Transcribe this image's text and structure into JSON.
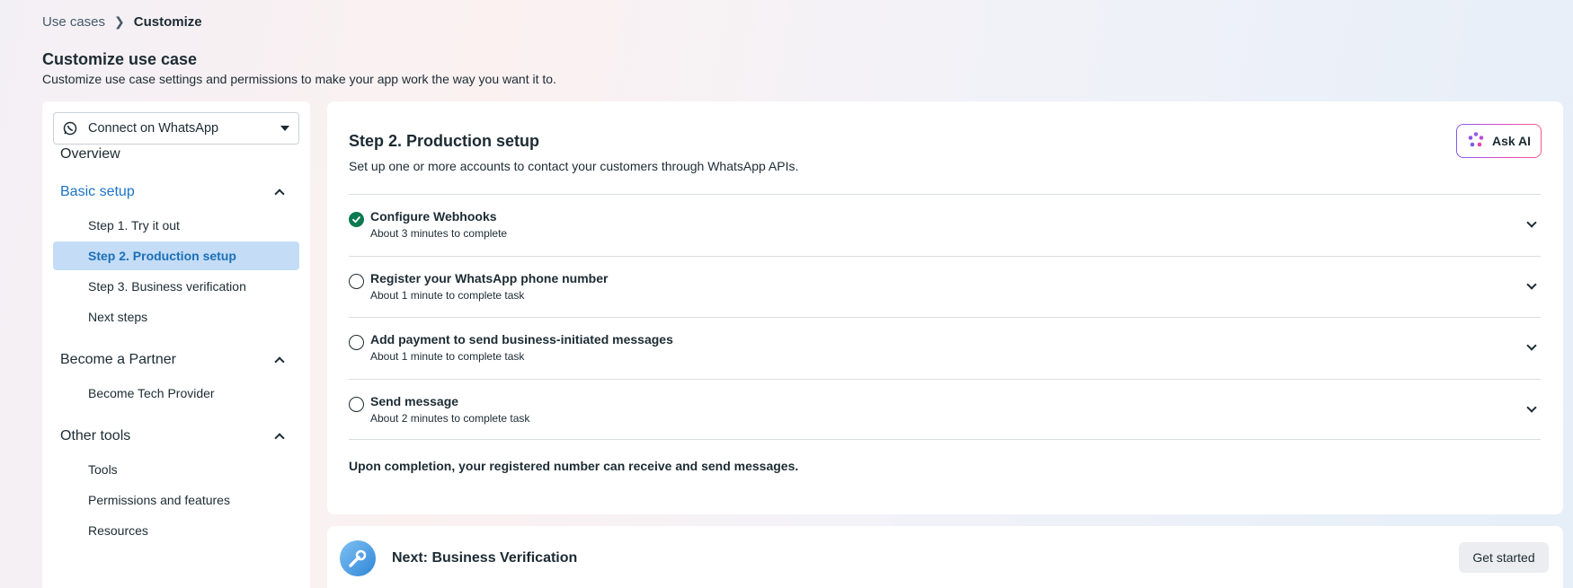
{
  "breadcrumb": {
    "parent": "Use cases",
    "current": "Customize"
  },
  "header": {
    "title": "Customize use case",
    "subtitle": "Customize use case settings and permissions to make your app work the way you want it to."
  },
  "sidebar": {
    "use_case_select": {
      "value": "Connect on WhatsApp",
      "icon": "whatsapp-icon"
    },
    "overview_label": "Overview",
    "sections": [
      {
        "label": "Basic setup",
        "active": true,
        "items": [
          "Step 1. Try it out",
          "Step 2. Production setup",
          "Step 3. Business verification",
          "Next steps"
        ]
      },
      {
        "label": "Become a Partner",
        "items": [
          "Become Tech Provider"
        ]
      },
      {
        "label": "Other tools",
        "items": [
          "Tools",
          "Permissions and features",
          "Resources"
        ]
      }
    ],
    "selected_item": "Step 2. Production setup"
  },
  "main": {
    "title": "Step 2. Production setup",
    "subtitle": "Set up one or more accounts to contact your customers through WhatsApp APIs.",
    "ask_ai_label": "Ask AI",
    "steps": [
      {
        "title": "Configure Webhooks",
        "time": "About 3 minutes to complete",
        "done": true
      },
      {
        "title": "Register your WhatsApp phone number",
        "time": "About 1 minute to complete task",
        "done": false
      },
      {
        "title": "Add payment to send business-initiated messages",
        "time": "About 1 minute to complete task",
        "done": false
      },
      {
        "title": "Send message",
        "time": "About 2 minutes to complete task",
        "done": false
      }
    ],
    "completion_note": "Upon completion, your registered number can receive and send messages."
  },
  "next": {
    "title": "Next: Business Verification",
    "button_label": "Get started"
  },
  "colors": {
    "accent": "#1b74c5",
    "selected_bg": "#c4dcf5",
    "done_green": "#0c7a50"
  }
}
